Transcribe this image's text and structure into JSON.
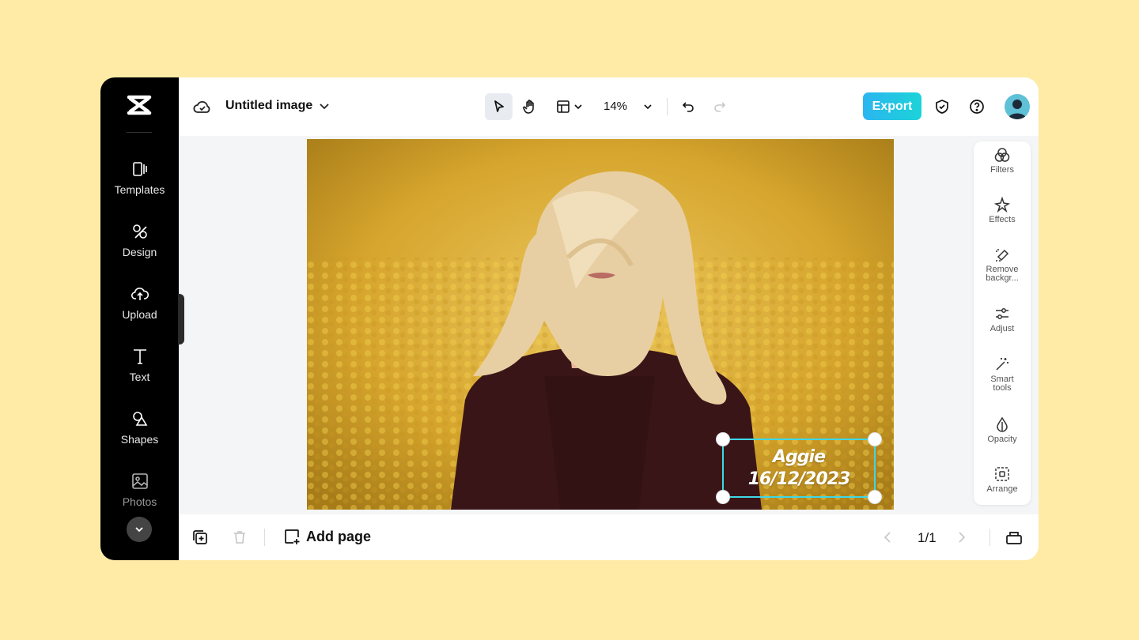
{
  "sidebar": {
    "items": [
      {
        "label": "Templates",
        "icon": "templates-icon"
      },
      {
        "label": "Design",
        "icon": "design-icon"
      },
      {
        "label": "Upload",
        "icon": "upload-icon"
      },
      {
        "label": "Text",
        "icon": "text-icon"
      },
      {
        "label": "Shapes",
        "icon": "shapes-icon"
      },
      {
        "label": "Photos",
        "icon": "photos-icon"
      }
    ]
  },
  "topbar": {
    "title": "Untitled image",
    "zoom": "14%",
    "export_label": "Export"
  },
  "canvas": {
    "text_line1": "Aggie",
    "text_line2": "16/12/2023"
  },
  "right_panel": {
    "items": [
      {
        "label": "Filters"
      },
      {
        "label": "Effects"
      },
      {
        "label": "Remove backgr..."
      },
      {
        "label": "Adjust"
      },
      {
        "label": "Smart tools"
      },
      {
        "label": "Opacity"
      },
      {
        "label": "Arrange"
      }
    ]
  },
  "bottombar": {
    "add_page_label": "Add page",
    "page_indicator": "1/1"
  },
  "colors": {
    "background": "#FFEBA6",
    "accent": "#2BB5F0",
    "selection": "#3FD7E6"
  }
}
